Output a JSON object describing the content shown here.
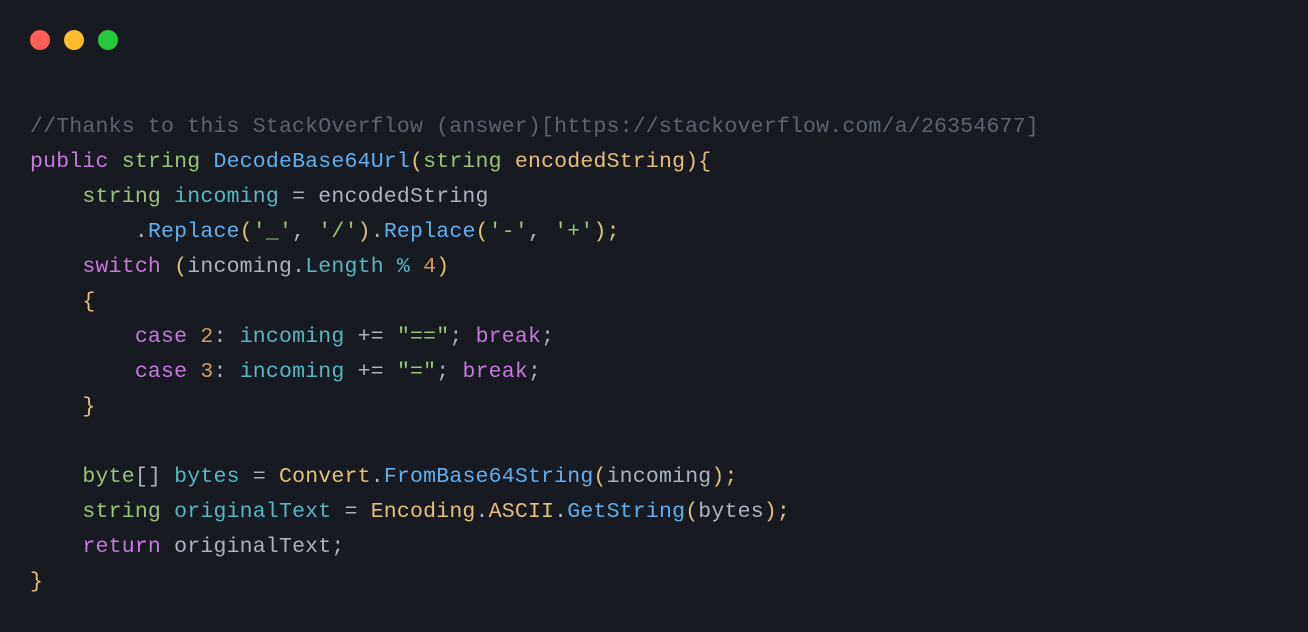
{
  "window": {
    "traffic_lights": {
      "red": "#FF5F56",
      "yellow": "#FFBD2E",
      "green": "#27C93F"
    }
  },
  "theme": {
    "background": "#171B21",
    "comment": "#5C6370",
    "keyword": "#C678DD",
    "type": "#98C379",
    "method": "#61AFEF",
    "param": "#E5C07B",
    "member": "#56B6C2",
    "string": "#98C379",
    "number": "#D19A66",
    "plain": "#ABB2BF",
    "punct": "#E6E6E6",
    "brace": "#E5C07B"
  },
  "code": {
    "line1_comment": "//Thanks to this StackOverflow (answer)[https://stackoverflow.com/a/26354677]",
    "sig": {
      "public": "public",
      "string1": "string",
      "method": "DecodeBase64Url",
      "lparen": "(",
      "string2": "string",
      "param": "encodedString",
      "rparen_brace": "){"
    },
    "decl1": {
      "indent": "    ",
      "type": "string",
      "var": "incoming",
      "eq": " = ",
      "rhs": "encodedString"
    },
    "chain": {
      "indent": "        ",
      "dot1": ".",
      "replace1": "Replace",
      "open1": "(",
      "s1a": "'_'",
      "comma1": ", ",
      "s1b": "'/'",
      "close1": ")",
      "dot2": ".",
      "replace2": "Replace",
      "open2": "(",
      "s2a": "'-'",
      "comma2": ", ",
      "s2b": "'+'",
      "close2_semi": ");"
    },
    "switch": {
      "indent": "    ",
      "kw": "switch",
      "sp": " ",
      "open": "(",
      "var": "incoming",
      "dot": ".",
      "prop": "Length",
      "mod": " % ",
      "num": "4",
      "close": ")"
    },
    "brace_open": {
      "indent": "    ",
      "b": "{"
    },
    "case1": {
      "indent": "        ",
      "kw": "case",
      "sp": " ",
      "num": "2",
      "colon": ": ",
      "var": "incoming",
      "op": " += ",
      "str": "\"==\"",
      "semi1": "; ",
      "break": "break",
      "semi2": ";"
    },
    "case2": {
      "indent": "        ",
      "kw": "case",
      "sp": " ",
      "num": "3",
      "colon": ": ",
      "var": "incoming",
      "op": " += ",
      "str": "\"=\"",
      "semi1": "; ",
      "break": "break",
      "semi2": ";"
    },
    "brace_close": {
      "indent": "    ",
      "b": "}"
    },
    "blank": "",
    "bytes_line": {
      "indent": "    ",
      "type": "byte",
      "brackets": "[]",
      "sp": " ",
      "var": "bytes",
      "eq": " = ",
      "convert": "Convert",
      "dot": ".",
      "method": "FromBase64String",
      "open": "(",
      "arg": "incoming",
      "close_semi": ");"
    },
    "orig_line": {
      "indent": "    ",
      "type": "string",
      "sp": " ",
      "var": "originalText",
      "eq": " = ",
      "encoding": "Encoding",
      "dot1": ".",
      "ascii": "ASCII",
      "dot2": ".",
      "method": "GetString",
      "open": "(",
      "arg": "bytes",
      "close_semi": ");"
    },
    "return_line": {
      "indent": "    ",
      "kw": "return",
      "sp": " ",
      "var": "originalText",
      "semi": ";"
    },
    "end_brace": "}"
  }
}
